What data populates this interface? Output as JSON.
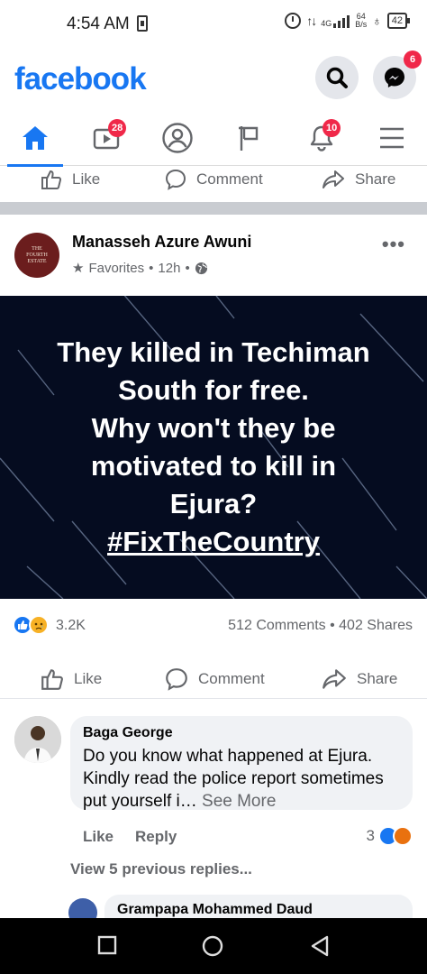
{
  "status_bar": {
    "time": "4:54 AM",
    "network": "4G",
    "speed_value": "64",
    "speed_unit": "B/s",
    "battery": "42"
  },
  "header": {
    "logo": "facebook",
    "messenger_badge": "6"
  },
  "nav": {
    "video_badge": "28",
    "notifications_badge": "10"
  },
  "top_actions": {
    "like": "Like",
    "comment": "Comment",
    "share": "Share"
  },
  "post": {
    "author": "Manasseh Azure Awuni",
    "avatar_text": "THE FOURTH ESTATE",
    "audience": "Favorites",
    "time": "12h",
    "image_lines": [
      "They killed in Techiman",
      "South for free.",
      "Why won't they be",
      "motivated to kill in",
      "Ejura?"
    ],
    "hashtag": "#FixTheCountry",
    "reactions_count": "3.2K",
    "comments_shares": "512 Comments • 402 Shares",
    "actions": {
      "like": "Like",
      "comment": "Comment",
      "share": "Share"
    },
    "colors": {
      "brand": "#1877f2",
      "badge": "#f02849",
      "image_bg": "#050c20"
    }
  },
  "comment": {
    "author": "Baga George",
    "text": "Do you know what happened at Ejura. Kindly read the police report sometimes put yourself i…",
    "see_more": "See More",
    "like": "Like",
    "reply": "Reply",
    "reaction_count": "3",
    "view_replies": "View 5 previous replies..."
  },
  "reply": {
    "author": "Grampapa Mohammed Daud"
  }
}
